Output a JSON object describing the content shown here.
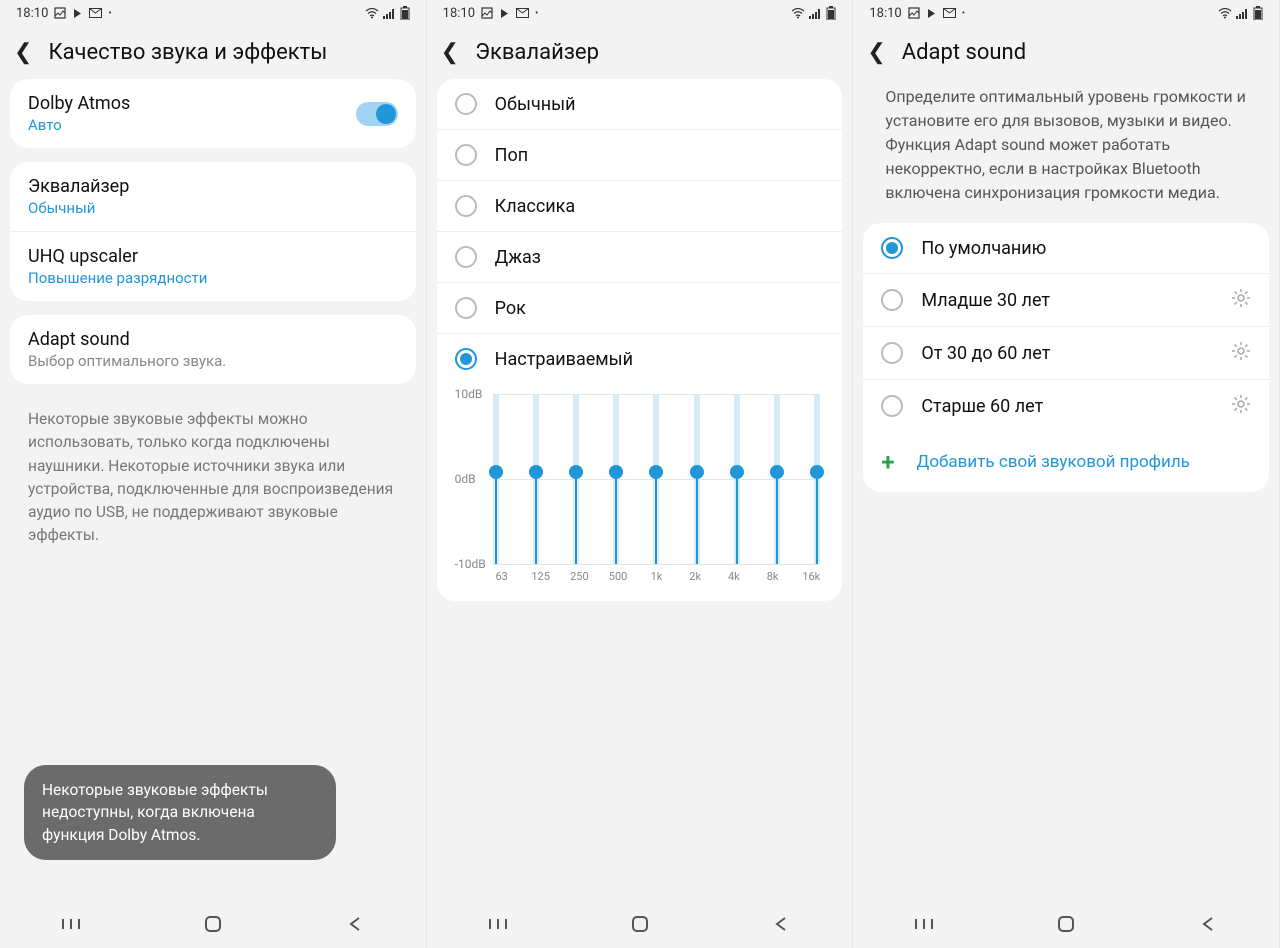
{
  "status": {
    "time": "18:10"
  },
  "screen1": {
    "title": "Качество звука и эффекты",
    "dolby": {
      "title": "Dolby Atmos",
      "sub": "Авто"
    },
    "eq": {
      "title": "Эквалайзер",
      "sub": "Обычный"
    },
    "uhq": {
      "title": "UHQ upscaler",
      "sub": "Повышение разрядности"
    },
    "adapt": {
      "title": "Adapt sound",
      "sub": "Выбор оптимального звука."
    },
    "help": "Некоторые звуковые эффекты можно использовать, только когда подключены наушники. Некоторые источники звука или устройства, подключенные для воспроизведения аудио по USB, не поддерживают звуковые эффекты.",
    "toast": "Некоторые звуковые эффекты недоступны, когда включена функция Dolby Atmos."
  },
  "screen2": {
    "title": "Эквалайзер",
    "presets": [
      "Обычный",
      "Поп",
      "Классика",
      "Джаз",
      "Рок",
      "Настраиваемый"
    ],
    "selected_index": 5,
    "chart_data": {
      "type": "bar",
      "ylim": [
        -10,
        10
      ],
      "ylabels": [
        "10dB",
        "0dB",
        "-10dB"
      ],
      "bands": [
        "63",
        "125",
        "250",
        "500",
        "1k",
        "2k",
        "4k",
        "8k",
        "16k"
      ],
      "values": [
        0,
        0,
        0,
        0,
        0,
        0,
        0,
        0,
        0
      ]
    }
  },
  "screen3": {
    "title": "Adapt sound",
    "desc": "Определите оптимальный уровень громкости и установите его для вызовов, музыки и видео.\nФункция Adapt sound может работать некорректно, если в настройках Bluetooth включена синхронизация громкости медиа.",
    "options": [
      "По умолчанию",
      "Младше 30 лет",
      "От 30 до 60 лет",
      "Старше 60 лет"
    ],
    "selected_index": 0,
    "add": "Добавить свой звуковой профиль"
  }
}
